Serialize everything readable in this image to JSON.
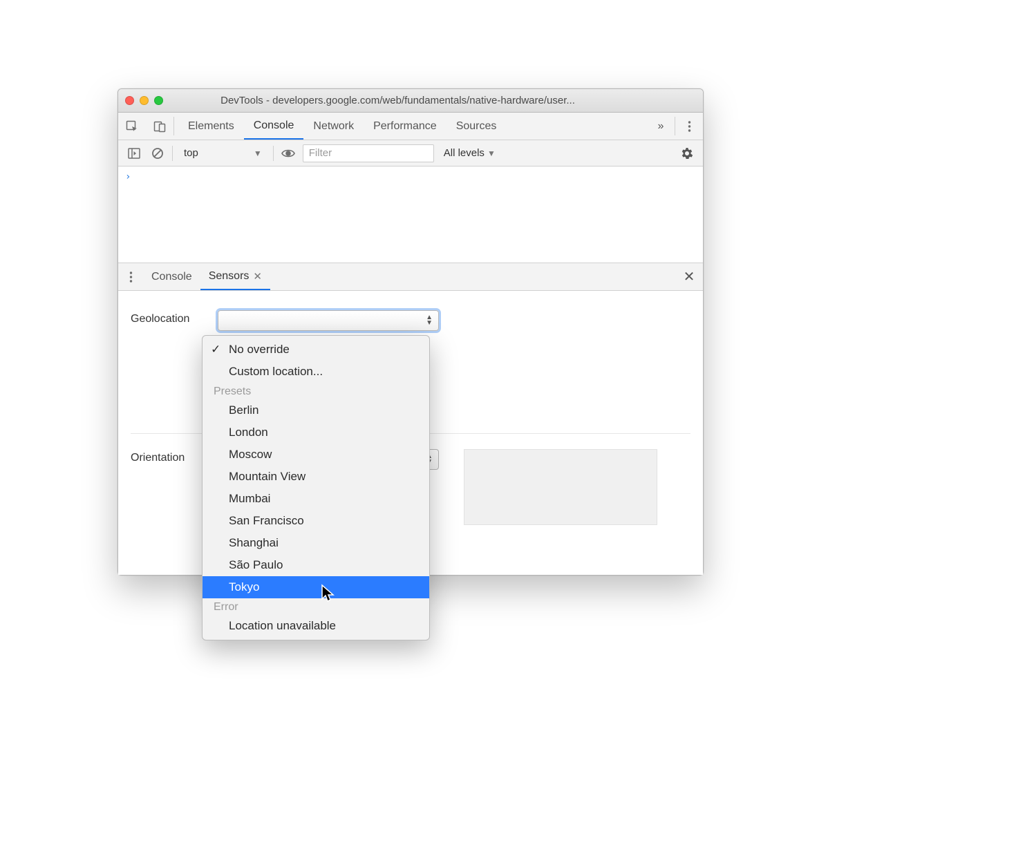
{
  "window": {
    "title": "DevTools - developers.google.com/web/fundamentals/native-hardware/user..."
  },
  "tabs": {
    "items": [
      "Elements",
      "Console",
      "Network",
      "Performance",
      "Sources"
    ],
    "active": "Console",
    "overflow_glyph": "»"
  },
  "console_toolbar": {
    "context": "top",
    "filter_placeholder": "Filter",
    "levels_label": "All levels"
  },
  "console": {
    "prompt": "›"
  },
  "drawer": {
    "tabs": [
      "Console",
      "Sensors"
    ],
    "active": "Sensors"
  },
  "sensors": {
    "geolocation_label": "Geolocation",
    "orientation_label": "Orientation"
  },
  "dropdown": {
    "options_top": [
      {
        "label": "No override",
        "selected": true
      },
      {
        "label": "Custom location...",
        "selected": false
      }
    ],
    "presets_header": "Presets",
    "presets": [
      "Berlin",
      "London",
      "Moscow",
      "Mountain View",
      "Mumbai",
      "San Francisco",
      "Shanghai",
      "São Paulo",
      "Tokyo"
    ],
    "highlighted": "Tokyo",
    "error_header": "Error",
    "error_items": [
      "Location unavailable"
    ]
  }
}
